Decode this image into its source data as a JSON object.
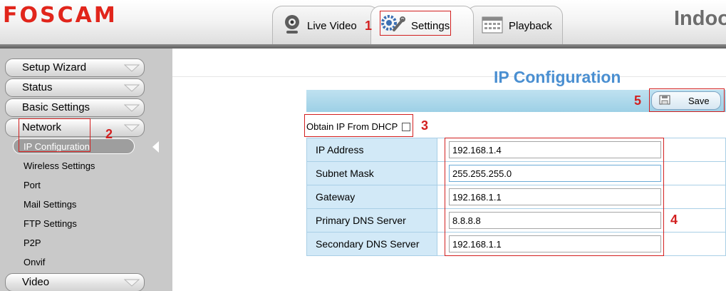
{
  "header": {
    "logo": "FOSCAM",
    "device_name": "Indoor",
    "tabs": [
      {
        "label": "Live Video",
        "icon": "webcam-icon"
      },
      {
        "label": "Settings",
        "icon": "gears-icon"
      },
      {
        "label": "Playback",
        "icon": "calendar-icon"
      }
    ]
  },
  "sidebar": {
    "menus": [
      "Setup Wizard",
      "Status",
      "Basic Settings",
      "Network",
      "Video"
    ],
    "network_items": [
      "IP Configuration",
      "Wireless Settings",
      "Port",
      "Mail Settings",
      "FTP Settings",
      "P2P",
      "Onvif"
    ]
  },
  "main": {
    "title": "IP Configuration",
    "save_label": "Save",
    "dhcp_label": "Obtain IP From DHCP",
    "fields": [
      {
        "label": "IP Address",
        "value": "192.168.1.4"
      },
      {
        "label": "Subnet Mask",
        "value": "255.255.255.0"
      },
      {
        "label": "Gateway",
        "value": "192.168.1.1"
      },
      {
        "label": "Primary DNS Server",
        "value": "8.8.8.8"
      },
      {
        "label": "Secondary DNS Server",
        "value": "192.168.1.1"
      }
    ]
  },
  "annotations": [
    "1",
    "2",
    "3",
    "4",
    "5"
  ],
  "colors": {
    "brand": "#e1251b",
    "title": "#4a8fd1",
    "annotation": "#d21f1f",
    "table_label_bg": "#d2e9f7"
  }
}
